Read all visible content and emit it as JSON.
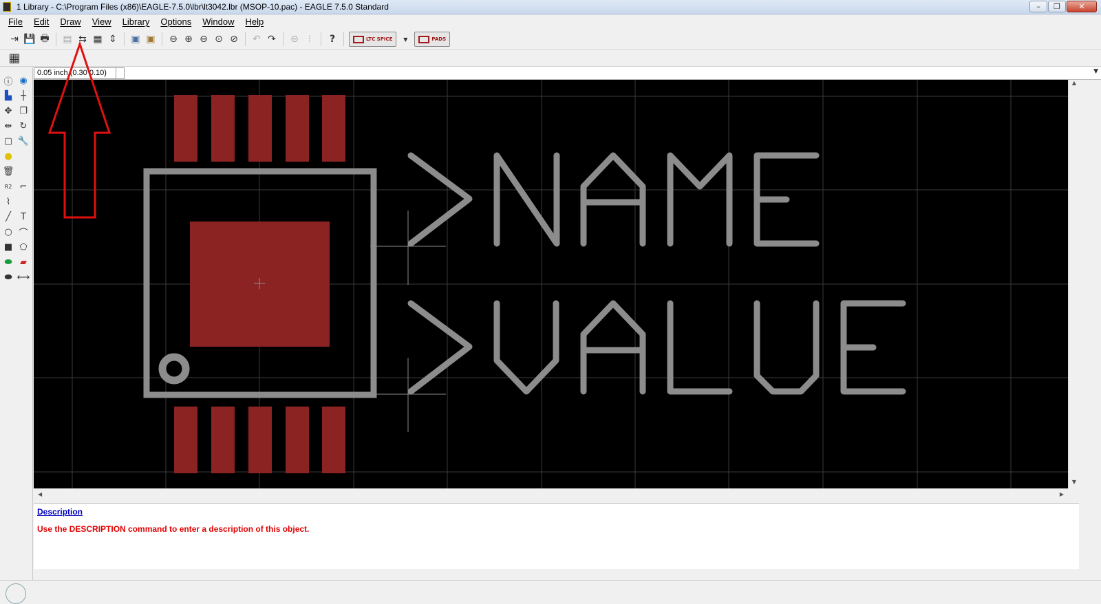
{
  "window": {
    "title": "1 Library - C:\\Program Files (x86)\\EAGLE-7.5.0\\lbr\\lt3042.lbr (MSOP-10.pac) - EAGLE 7.5.0 Standard",
    "minimize": "–",
    "maximize": "❐",
    "close": "✕"
  },
  "menu": [
    "File",
    "Edit",
    "Draw",
    "View",
    "Library",
    "Options",
    "Window",
    "Help"
  ],
  "toolbar": {
    "ltspice_label": "LTC SPICE",
    "pads_label": "PADS"
  },
  "coordinate": {
    "value": "0.05 inch (0.30 0.10)"
  },
  "canvas": {
    "name_text": ">NAME",
    "value_text": ">VALUE",
    "colors": {
      "background": "#000000",
      "pad": "#8b2323",
      "outline": "#8c8c8c",
      "grid": "#3a3a3a"
    }
  },
  "description": {
    "heading": "Description",
    "text": "Use the DESCRIPTION command to enter a description of this object."
  },
  "annotation": {
    "color": "#e01010",
    "shape": "arrow-up"
  }
}
